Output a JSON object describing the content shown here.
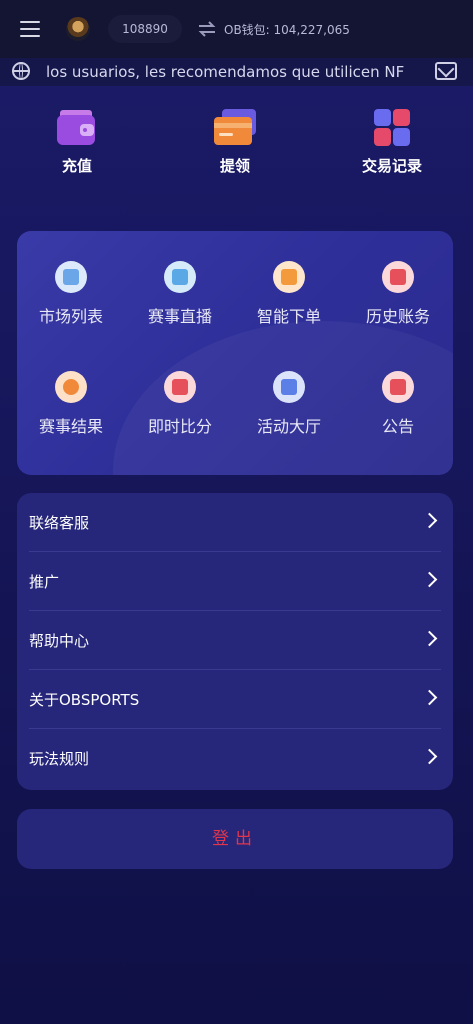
{
  "header": {
    "balance": "108890",
    "wallet_label": "OB钱包: 104,227,065"
  },
  "marquee": {
    "text": "los usuarios, les recomendamos que utilicen NF"
  },
  "quick_actions": [
    {
      "label": "充值",
      "icon": "wallet-icon"
    },
    {
      "label": "提领",
      "icon": "card-icon"
    },
    {
      "label": "交易记录",
      "icon": "grid-squares-icon"
    }
  ],
  "grid": [
    {
      "label": "市场列表",
      "icon": "document-icon",
      "color": "#6aa6e8"
    },
    {
      "label": "赛事直播",
      "icon": "tv-play-icon",
      "color": "#5aa9e6"
    },
    {
      "label": "智能下单",
      "icon": "edit-icon",
      "color": "#f39a3d"
    },
    {
      "label": "历史账务",
      "icon": "clock-receipt-icon",
      "color": "#e6505a"
    },
    {
      "label": "赛事结果",
      "icon": "medal-icon",
      "color": "#f08a3a"
    },
    {
      "label": "即时比分",
      "icon": "scoreboard-icon",
      "color": "#e6505a"
    },
    {
      "label": "活动大厅",
      "icon": "flag-icon",
      "color": "#5b7fe6"
    },
    {
      "label": "公告",
      "icon": "megaphone-icon",
      "color": "#e6505a"
    }
  ],
  "menu": [
    {
      "label": "联络客服"
    },
    {
      "label": "推广"
    },
    {
      "label": "帮助中心"
    },
    {
      "label": "关于OBSPORTS"
    },
    {
      "label": "玩法规则"
    }
  ],
  "logout_label": "登出"
}
